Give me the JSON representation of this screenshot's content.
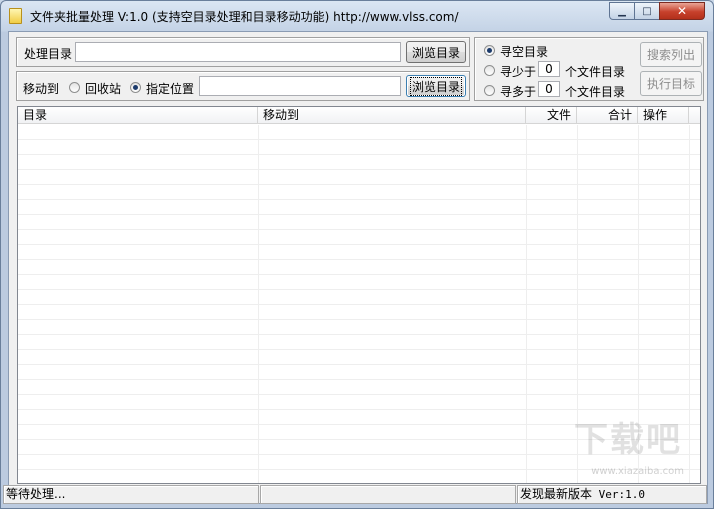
{
  "window": {
    "title": "文件夹批量处理 V:1.0 (支持空目录处理和目录移动功能) http://www.vlss.com/",
    "caption_buttons": {
      "minimize": "▁",
      "maximize": "□",
      "close": "✕"
    }
  },
  "source": {
    "label": "处理目录",
    "value": "",
    "browse_label": "浏览目录"
  },
  "move": {
    "label": "移动到",
    "option_recycle": "回收站",
    "option_location": "指定位置",
    "selected": "指定位置",
    "value": "",
    "browse_label": "浏览目录"
  },
  "search_mode": {
    "option_empty": "寻空目录",
    "option_less_prefix": "寻少于",
    "option_more_prefix": "寻多于",
    "less_value": "0",
    "more_value": "0",
    "suffix": "个文件目录",
    "selected": "寻空目录"
  },
  "actions": {
    "search_label": "搜索列出",
    "execute_label": "执行目标"
  },
  "table": {
    "columns": [
      "目录",
      "移动到",
      "文件",
      "合计",
      "操作"
    ],
    "rows": []
  },
  "status": {
    "state": "等待处理...",
    "middle": "",
    "update_label": "发现最新版本",
    "version": "Ver:1.0"
  },
  "watermark": {
    "text": "下载吧",
    "url": "www.xiazaiba.com"
  }
}
